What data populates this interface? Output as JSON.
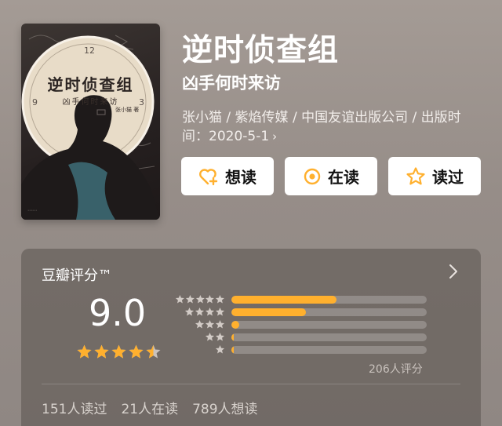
{
  "book": {
    "title": "逆时侦查组",
    "subtitle": "凶手何时来访",
    "meta_line": "张小猫 / 紫焰传媒 / 中国友谊出版公司 / 出版时间：2020-5-1",
    "meta_chevron": "›",
    "cover": {
      "title": "逆时侦查组",
      "subtitle": "凶手何时来访",
      "author": "张小猫 著"
    }
  },
  "actions": {
    "want": {
      "label": "想读",
      "icon": "heart-plus-icon"
    },
    "reading": {
      "label": "在读",
      "icon": "target-icon"
    },
    "read": {
      "label": "读过",
      "icon": "star-outline-icon"
    }
  },
  "rating": {
    "title": "豆瓣评分™",
    "score": "9.0",
    "stars": 4.5,
    "distribution": [
      {
        "stars": 5,
        "fraction": 0.54
      },
      {
        "stars": 4,
        "fraction": 0.38
      },
      {
        "stars": 3,
        "fraction": 0.04
      },
      {
        "stars": 2,
        "fraction": 0.008
      },
      {
        "stars": 1,
        "fraction": 0.008
      }
    ],
    "count_label": "206人评分",
    "stats": [
      "151人读过",
      "21人在读",
      "789人想读"
    ]
  },
  "colors": {
    "accent": "#ffb02e",
    "star_empty": "#c9c2bd"
  }
}
